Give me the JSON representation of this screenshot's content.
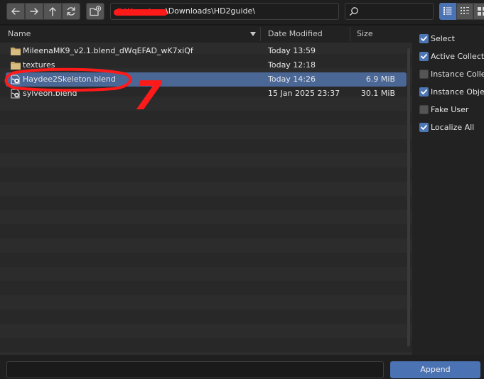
{
  "header": {
    "path_prefix": "C:\\Users\\",
    "path_visible": "\\Downloads\\HD2guide\\",
    "search": {
      "value": "",
      "placeholder": ""
    }
  },
  "toolbar": {
    "icons": [
      "arrow-left-icon",
      "arrow-right-icon",
      "arrow-up-icon",
      "refresh-icon",
      "new-folder-icon",
      "search-icon",
      "list-view-icon",
      "grid-view-icon",
      "thumbnail-view-icon"
    ]
  },
  "columns": {
    "name": "Name",
    "date": "Date Modified",
    "size": "Size"
  },
  "files": [
    {
      "name": "MileenaMK9_v2.1.blend_dWqEFAD_wK7xiQf",
      "date": "Today 13:59",
      "size": "",
      "kind": "folder",
      "selected": false
    },
    {
      "name": "textures",
      "date": "Today 12:18",
      "size": "",
      "kind": "folder",
      "selected": false
    },
    {
      "name": "Haydee2Skeleton.blend",
      "date": "Today 14:26",
      "size": "6.9 MiB",
      "kind": "blend",
      "selected": true
    },
    {
      "name": "sylveon.blend",
      "date": "15 Jan 2025 23:37",
      "size": "30.1 MiB",
      "kind": "blend",
      "selected": false
    }
  ],
  "options": [
    {
      "label": "Select",
      "checked": true
    },
    {
      "label": "Active Collection",
      "checked": true
    },
    {
      "label": "Instance Collections",
      "checked": false
    },
    {
      "label": "Instance Object Data",
      "checked": true
    },
    {
      "label": "Fake User",
      "checked": false
    },
    {
      "label": "Localize All",
      "checked": true
    }
  ],
  "footer": {
    "filename": {
      "value": "",
      "placeholder": ""
    },
    "append_label": "Append"
  },
  "annotation": {
    "step_label": "7",
    "color": "#ff1a1a"
  },
  "colors": {
    "accent": "#4b72b3",
    "selection": "#4a6796",
    "background": "#181818"
  }
}
